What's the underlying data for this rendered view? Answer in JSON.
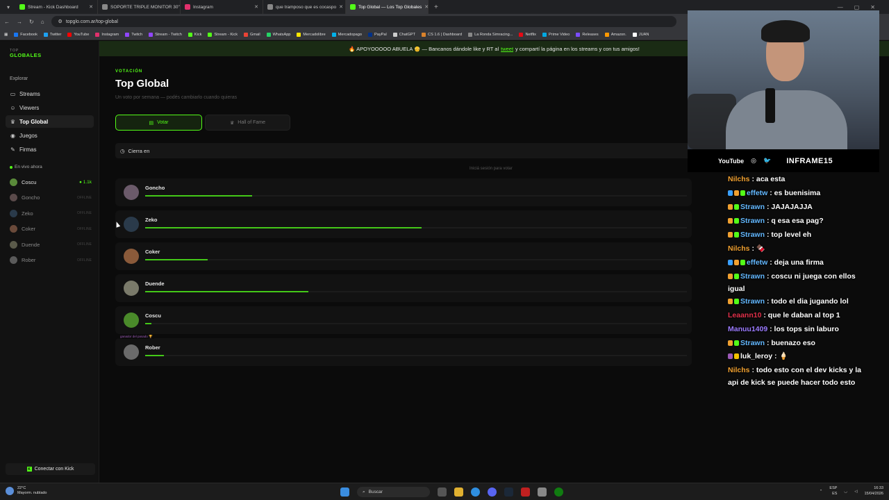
{
  "browser": {
    "tabs": [
      {
        "title": "Stream - Kick Dashboard",
        "color": "#53fc18"
      },
      {
        "title": "SOPORTE TRIPLE MONITOR 30\"",
        "color": "#888888"
      },
      {
        "title": "Instagram",
        "color": "#e1306c"
      },
      {
        "title": "que tramposo que es cocaspo",
        "color": "#888888"
      },
      {
        "title": "Top Global — Los Top Globales",
        "color": "#53fc18"
      }
    ],
    "url": "topglo.com.ar/top-global",
    "bookmarks": [
      {
        "label": "Facebook",
        "color": "#1877f2"
      },
      {
        "label": "Twitter",
        "color": "#1da1f2"
      },
      {
        "label": "YouTube",
        "color": "#ff0000"
      },
      {
        "label": "Instagram",
        "color": "#e1306c"
      },
      {
        "label": "Twitch",
        "color": "#9146ff"
      },
      {
        "label": "Stream - Twitch",
        "color": "#9146ff"
      },
      {
        "label": "Kick",
        "color": "#53fc18"
      },
      {
        "label": "Stream - Kick",
        "color": "#53fc18"
      },
      {
        "label": "Gmail",
        "color": "#ea4335"
      },
      {
        "label": "WhatsApp",
        "color": "#25d366"
      },
      {
        "label": "Mercadolibre",
        "color": "#ffe600"
      },
      {
        "label": "Mercadopago",
        "color": "#00b1ea"
      },
      {
        "label": "PayPal",
        "color": "#003087"
      },
      {
        "label": "ChatGPT",
        "color": "#cccccc"
      },
      {
        "label": "CS 1.6 | Dashboard",
        "color": "#d9822b"
      },
      {
        "label": "La Ronda Simracing...",
        "color": "#888888"
      },
      {
        "label": "Netflix",
        "color": "#e50914"
      },
      {
        "label": "Prime Video",
        "color": "#00a8e1"
      },
      {
        "label": "Releases",
        "color": "#7b4cff"
      },
      {
        "label": "Amazon.",
        "color": "#ff9900"
      },
      {
        "label": "JUAN",
        "color": "#ffffff"
      }
    ]
  },
  "sidebar": {
    "logo_top": "TOP",
    "logo_main": "GLOBALES",
    "explore_label": "Explorar",
    "nav": [
      {
        "label": "Streams",
        "icon": "calendar-icon",
        "glyph": "▭"
      },
      {
        "label": "Viewers",
        "icon": "users-icon",
        "glyph": "☺"
      },
      {
        "label": "Top Global",
        "icon": "trophy-icon",
        "glyph": "♛"
      },
      {
        "label": "Juegos",
        "icon": "gamepad-icon",
        "glyph": "◉"
      },
      {
        "label": "Firmas",
        "icon": "pen-icon",
        "glyph": "✎"
      }
    ],
    "live_label": "En vivo ahora",
    "live": [
      {
        "name": "Coscu",
        "status": "● 1.1k",
        "color": "#5a8a3a"
      },
      {
        "name": "Goncho",
        "status": "OFFLINE",
        "color": "#5a4a4a"
      },
      {
        "name": "Zeko",
        "status": "OFFLINE",
        "color": "#2a3a4a"
      },
      {
        "name": "Coker",
        "status": "OFFLINE",
        "color": "#6a4a3a"
      },
      {
        "name": "Duende",
        "status": "OFFLINE",
        "color": "#5a5a4a"
      },
      {
        "name": "Rober",
        "status": "OFFLINE",
        "color": "#5a5a5a"
      }
    ],
    "connect_label": "Conectar con Kick"
  },
  "banner": {
    "prefix": "🔥 APOYOOOOO ABUELA 👴 — Bancanos dándole like y RT al",
    "link": "tweet",
    "suffix": "y compartí la página en los streams y con tus amigos!"
  },
  "page": {
    "eyebrow": "VOTACIÓN",
    "title": "Top Global",
    "subtitle": "Un voto por semana — podés cambiarlo cuando quieras",
    "vote_label": "Votar",
    "hof_label": "Hall of Fame",
    "closes_label": "Cierra en",
    "login_hint": "Iniciá sesión para votar"
  },
  "ranking": [
    {
      "name": "Goncho",
      "share": 17,
      "color": "#6b5a6a",
      "tag": ""
    },
    {
      "name": "Zeko",
      "share": 44,
      "color": "#2a3a4a",
      "tag": ""
    },
    {
      "name": "Coker",
      "share": 10,
      "color": "#8a5a3a",
      "tag": ""
    },
    {
      "name": "Duende",
      "share": 26,
      "color": "#7a7a6a",
      "tag": ""
    },
    {
      "name": "Coscu",
      "share": 1,
      "color": "#4a8a2a",
      "tag": ""
    },
    {
      "name": "Rober",
      "share": 3,
      "color": "#6a6a6a",
      "tag": "ganador del pasado 🏆"
    }
  ],
  "overlay": {
    "youtube": "YouTube",
    "handle": "INFRAME15"
  },
  "chat": [
    {
      "user": "Nilchs",
      "color": "#f0a030",
      "text": ": aca esta",
      "badges": []
    },
    {
      "user": "effetw",
      "color": "#63b8ff",
      "text": ": es buenisima",
      "badges": [
        "#3aa0ff",
        "#f0a030",
        "#53fc18"
      ]
    },
    {
      "user": "Strawn",
      "color": "#63b8ff",
      "text": ": JAJAJAJJA",
      "badges": [
        "#f0a030",
        "#53fc18"
      ]
    },
    {
      "user": "Strawn",
      "color": "#63b8ff",
      "text": ": q esa esa pag?",
      "badges": [
        "#f0a030",
        "#53fc18"
      ]
    },
    {
      "user": "Strawn",
      "color": "#63b8ff",
      "text": ": top level eh",
      "badges": [
        "#f0a030",
        "#53fc18"
      ]
    },
    {
      "user": "Nilchs",
      "color": "#f0a030",
      "text": ": 🍫",
      "badges": []
    },
    {
      "user": "effetw",
      "color": "#63b8ff",
      "text": ": deja una firma",
      "badges": [
        "#3aa0ff",
        "#f0a030",
        "#53fc18"
      ]
    },
    {
      "user": "Strawn",
      "color": "#63b8ff",
      "text": ": coscu ni juega con ellos igual",
      "badges": [
        "#f0a030",
        "#53fc18"
      ]
    },
    {
      "user": "Strawn",
      "color": "#63b8ff",
      "text": ": todo el dia jugando lol",
      "badges": [
        "#f0a030",
        "#53fc18"
      ]
    },
    {
      "user": "Leaann10",
      "color": "#e0304a",
      "text": ": que le daban al top 1",
      "badges": []
    },
    {
      "user": "Manuu1409",
      "color": "#9b7bff",
      "text": ": los tops sin laburo",
      "badges": []
    },
    {
      "user": "Strawn",
      "color": "#63b8ff",
      "text": ": buenazo eso",
      "badges": [
        "#f0a030",
        "#53fc18"
      ]
    },
    {
      "user": "luk_leroy",
      "color": "#ffffff",
      "text": ": 🍦",
      "badges": [
        "#9b59b6",
        "#f0c000"
      ]
    },
    {
      "user": "Nilchs",
      "color": "#f0a030",
      "text": ": todo esto con el dev kicks y la api de kick se puede hacer todo esto",
      "badges": []
    }
  ],
  "taskbar": {
    "temp": "22°C",
    "weather": "Mayorm. nublado",
    "search": "Buscar",
    "lang1": "ESP",
    "lang2": "ES",
    "time": "16:33",
    "date": "15/04/2026"
  }
}
